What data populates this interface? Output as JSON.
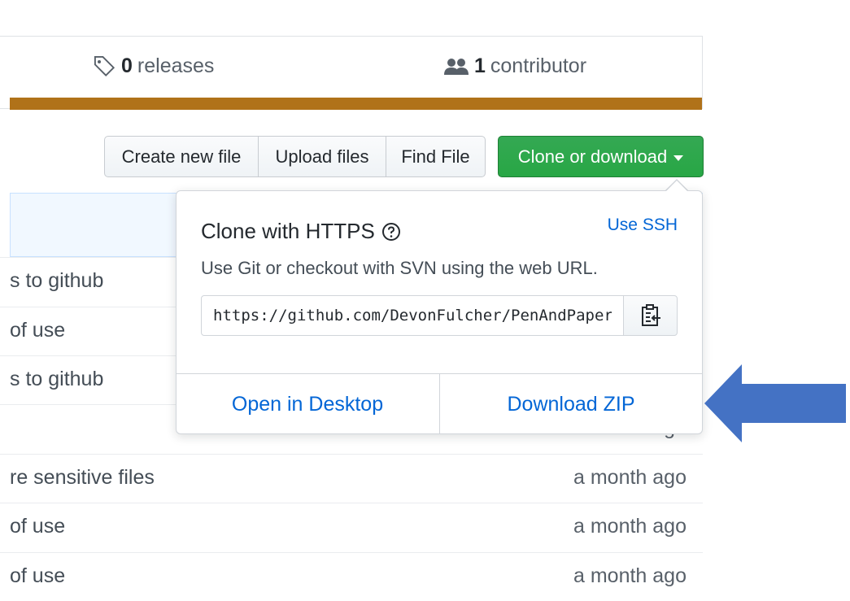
{
  "summary": {
    "releases": {
      "count": "0",
      "label": "releases",
      "icon": "tag-icon"
    },
    "contributors": {
      "count": "1",
      "label": "contributor",
      "icon": "people-icon"
    },
    "language_bar_color": "#b07219"
  },
  "toolbar": {
    "create_new_file": "Create new file",
    "upload_files": "Upload files",
    "find_file": "Find File",
    "clone_or_download": "Clone or download",
    "clone_color": "#28a745"
  },
  "files": [
    {
      "message": "s to github",
      "age": ""
    },
    {
      "message": " of use",
      "age": ""
    },
    {
      "message": "s to github",
      "age": ""
    },
    {
      "message": "",
      "age": "a month ago"
    },
    {
      "message": "re sensitive files",
      "age": "a month ago"
    },
    {
      "message": " of use",
      "age": "a month ago"
    },
    {
      "message": " of use",
      "age": "a month ago"
    }
  ],
  "clone_popup": {
    "title": "Clone with HTTPS",
    "help_icon": "question-icon",
    "use_ssh": "Use SSH",
    "description": "Use Git or checkout with SVN using the web URL.",
    "url": "https://github.com/DevonFulcher/PenAndPaper.git",
    "copy_icon": "clipboard-icon",
    "open_in_desktop": "Open in Desktop",
    "download_zip": "Download ZIP",
    "link_color": "#0366d6"
  },
  "annotation": {
    "arrow_color": "#4472c4",
    "arrow_icon": "arrow-left-icon"
  }
}
